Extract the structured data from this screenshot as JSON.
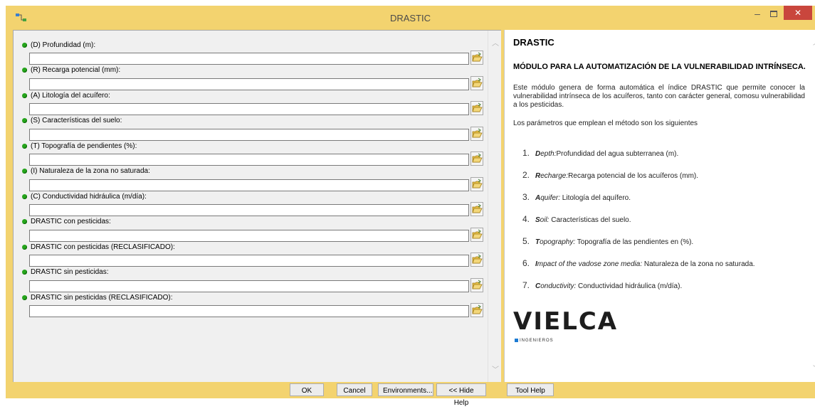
{
  "window": {
    "title": "DRASTIC",
    "close_glyph": "✕",
    "min_glyph": "–"
  },
  "params": [
    {
      "label": "(D) Profundidad (m):",
      "value": ""
    },
    {
      "label": "(R) Recarga potencial (mm):",
      "value": ""
    },
    {
      "label": "(A) Litología del acuífero:",
      "value": ""
    },
    {
      "label": "(S) Características del suelo:",
      "value": ""
    },
    {
      "label": "(T) Topografía de pendientes (%):",
      "value": ""
    },
    {
      "label": "(I) Naturaleza de la zona no saturada:",
      "value": ""
    },
    {
      "label": "(C) Conductividad hidráulica (m/día):",
      "value": ""
    },
    {
      "label": "DRASTIC con pesticidas:",
      "value": ""
    },
    {
      "label": "DRASTIC con pesticidas (RECLASIFICADO):",
      "value": ""
    },
    {
      "label": "DRASTIC sin pesticidas:",
      "value": ""
    },
    {
      "label": "DRASTIC sin pesticidas (RECLASIFICADO):",
      "value": ""
    }
  ],
  "help": {
    "title": "DRASTIC",
    "subtitle": "MÓDULO PARA LA AUTOMATIZACIÓN DE LA VULNERABILIDAD INTRÍNSECA.",
    "description": "Este módulo genera de forma automática el índice DRASTIC que permite conocer la vulnerabilidad intrínseca de los acuíferos, tanto con carácter general, comosu vulnerabilidad a los pesticidas.",
    "params_intro": "Los parámetros que emplean el método son los siguientes",
    "items": [
      {
        "num": "1.",
        "term": "Depth:",
        "text": "Profundidad del agua subterranea (m)."
      },
      {
        "num": "2.",
        "term": "Recharge:",
        "text": "Recarga potencial de los acuíferos (mm)."
      },
      {
        "num": "3.",
        "term": "Aquifer:",
        "text": " Litología del aquífero."
      },
      {
        "num": "4.",
        "term": "Soil:",
        "text": " Características del suelo."
      },
      {
        "num": "5.",
        "term": "Topography:",
        "text": " Topografía de las pendientes en (%)."
      },
      {
        "num": "6.",
        "term": "Impact of the vadose zone media:",
        "text": " Naturaleza de la zona no saturada."
      },
      {
        "num": "7.",
        "term": "Conductivity:",
        "text": " Conductividad hidráulica (m/día)."
      }
    ],
    "logo": {
      "name": "VIELCA",
      "sub": "INGENIEROS"
    }
  },
  "buttons": {
    "ok": "OK",
    "cancel": "Cancel",
    "environments": "Environments...",
    "hide_help": "<< Hide Help",
    "tool_help": "Tool Help"
  },
  "colors": {
    "frame": "#f3d36f",
    "close": "#c9463d",
    "dot": "#26a51c",
    "logo_accent": "#1c7bd3"
  }
}
